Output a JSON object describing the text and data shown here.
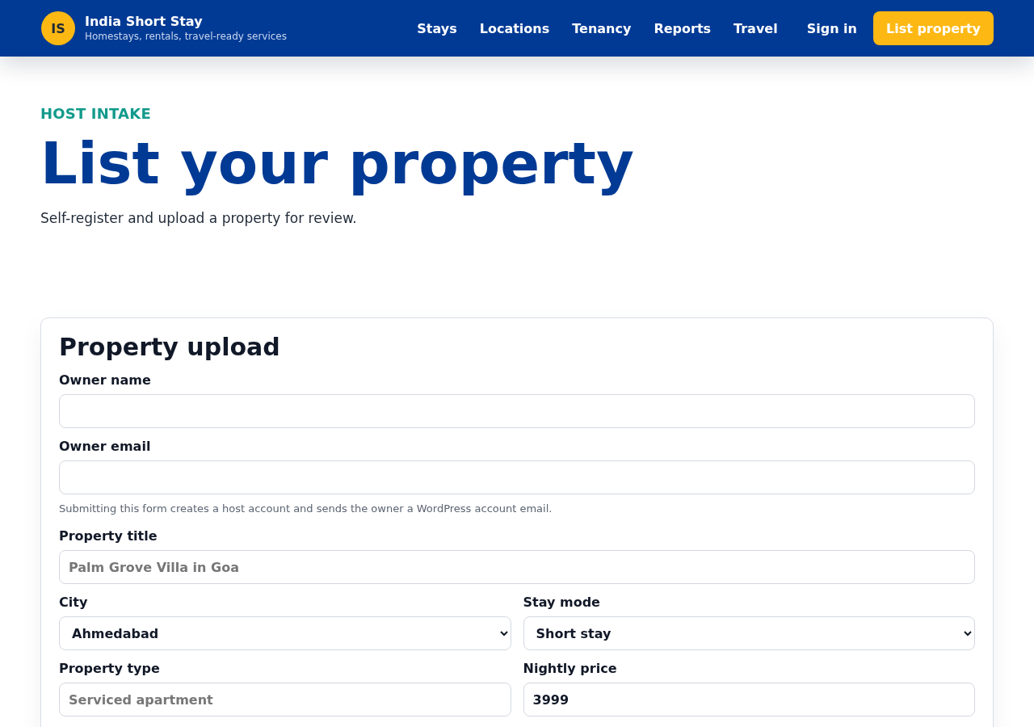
{
  "header": {
    "logo": {
      "initials": "IS"
    },
    "brand": {
      "name": "India Short Stay",
      "tagline": "Homestays, rentals, travel-ready services"
    },
    "nav": [
      {
        "label": "Stays"
      },
      {
        "label": "Locations"
      },
      {
        "label": "Tenancy"
      },
      {
        "label": "Reports"
      },
      {
        "label": "Travel"
      }
    ],
    "sign_in": "Sign in",
    "cta": "List property"
  },
  "hero": {
    "eyebrow": "HOST INTAKE",
    "title": "List your property",
    "subtitle": "Self-register and upload a property for review."
  },
  "form": {
    "title": "Property upload",
    "fields": [
      {
        "kind": "text",
        "label": "Owner name"
      },
      {
        "kind": "text",
        "label": "Owner email",
        "hint": "Submitting this form creates a host account and sends the owner a WordPress account email."
      },
      {
        "kind": "text",
        "label": "Property title",
        "placeholder": "Palm Grove Villa in Goa"
      },
      {
        "kind": "row",
        "fields": [
          {
            "kind": "select",
            "label": "City",
            "value": "Ahmedabad"
          },
          {
            "kind": "select",
            "label": "Stay mode",
            "value": "Short stay"
          }
        ]
      },
      {
        "kind": "row",
        "fields": [
          {
            "kind": "text",
            "label": "Property type",
            "placeholder": "Serviced apartment"
          },
          {
            "kind": "text",
            "label": "Nightly price",
            "value": "3999"
          }
        ]
      }
    ]
  }
}
